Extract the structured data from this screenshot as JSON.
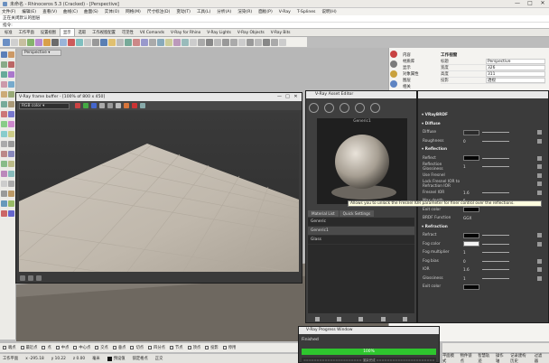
{
  "window": {
    "title": "未命名 - Rhinoceros 5.3 (Cracked) - [Perspective]",
    "min": "—",
    "max": "□",
    "close": "✕"
  },
  "menu": [
    "文件(F)",
    "编辑(E)",
    "查看(V)",
    "曲线(C)",
    "曲面(S)",
    "实体(O)",
    "网格(M)",
    "尺寸标注(D)",
    "变动(T)",
    "工具(L)",
    "分析(A)",
    "渲染(R)",
    "面板(P)",
    "V-Ray",
    "T-Splines",
    "说明(H)"
  ],
  "command": {
    "history": "正在关闭默认的图层",
    "prompt": "指令:"
  },
  "toolbar_tabs": [
    {
      "label": "标准",
      "active": false
    },
    {
      "label": "工作平面",
      "active": false
    },
    {
      "label": "设置视图",
      "active": false
    },
    {
      "label": "显示",
      "active": true
    },
    {
      "label": "选取",
      "active": false
    },
    {
      "label": "工作视窗配置",
      "active": false
    },
    {
      "label": "可见性",
      "active": false
    },
    {
      "label": "V4 Comands",
      "active": false
    },
    {
      "label": "V-Ray for Rhino",
      "active": false
    },
    {
      "label": "V-Ray Lights",
      "active": false
    },
    {
      "label": "V-Ray Objects",
      "active": false
    },
    {
      "label": "V-Ray Bits",
      "active": false
    }
  ],
  "viewport": {
    "label": "Perspective ▾"
  },
  "panel": {
    "list": [
      "内容",
      "材质库",
      "显示",
      "对象属性",
      "图层",
      "相关",
      "材质",
      "说明"
    ],
    "props_header": "工作视窗",
    "props": [
      {
        "k": "标题",
        "v": "Perspective"
      },
      {
        "k": "宽度",
        "v": "326"
      },
      {
        "k": "高度",
        "v": "311"
      },
      {
        "k": "投影",
        "v": "透视"
      }
    ]
  },
  "vfb": {
    "title": "V-Ray frame buffer - [100% of 800 x 450]",
    "channel": "RGB color ▾",
    "min": "—",
    "max": "□",
    "close": "✕"
  },
  "asset_editor": {
    "title": "V-Ray Asset Editor",
    "preview_label": "Generic1",
    "tabs": [
      "Material List",
      "Quick Settings"
    ],
    "items": [
      {
        "label": "Generic",
        "selected": false
      },
      {
        "label": "Generic1",
        "selected": true
      },
      {
        "label": "Glass",
        "selected": false
      }
    ]
  },
  "material": {
    "name": "VRayBRDF",
    "rows": [
      {
        "type": "section",
        "label": "▾ VRayBRDF"
      },
      {
        "type": "section",
        "label": "▾ Diffuse"
      },
      {
        "type": "row",
        "label": "Diffuse",
        "swatch": "#2b2b2b",
        "num": "",
        "slider": true,
        "check": true
      },
      {
        "type": "row",
        "label": "Roughness",
        "swatch": "",
        "num": "0",
        "slider": true,
        "check": true
      },
      {
        "type": "section",
        "label": "▾ Reflection"
      },
      {
        "type": "row",
        "label": "Reflect",
        "swatch": "#050505",
        "num": "",
        "slider": true,
        "check": true
      },
      {
        "type": "row",
        "label": "Reflection Glossiness",
        "swatch": "",
        "num": "1",
        "slider": true,
        "check": true
      },
      {
        "type": "row",
        "label": "Use Fresnel",
        "swatch": "",
        "num": "",
        "slider": false,
        "check": true
      },
      {
        "type": "row",
        "label": "Lock Fresnel IOR to Refraction IOR",
        "swatch": "",
        "num": "",
        "slider": false,
        "check": true
      },
      {
        "type": "row",
        "label": "Fresnel IOR",
        "swatch": "",
        "num": "1.6",
        "slider": true,
        "check": true
      },
      {
        "type": "row",
        "label": "Max depth",
        "swatch": "",
        "num": "5",
        "slider": true,
        "check": false
      },
      {
        "type": "row",
        "label": "Exit color",
        "swatch": "#050505",
        "num": "",
        "slider": false,
        "check": false
      },
      {
        "type": "row",
        "label": "BRDF Function",
        "swatch": "",
        "num": "GGX",
        "slider": false,
        "check": false
      },
      {
        "type": "section",
        "label": "▾ Refraction"
      },
      {
        "type": "row",
        "label": "Refract",
        "swatch": "#050505",
        "num": "",
        "slider": true,
        "check": true
      },
      {
        "type": "row",
        "label": "Fog color",
        "swatch": "#f4f4f4",
        "num": "",
        "slider": true,
        "check": true
      },
      {
        "type": "row",
        "label": "Fog multiplier",
        "swatch": "",
        "num": "1",
        "slider": true,
        "check": false
      },
      {
        "type": "row",
        "label": "Fog bias",
        "swatch": "",
        "num": "0",
        "slider": true,
        "check": true
      },
      {
        "type": "row",
        "label": "IOR",
        "swatch": "",
        "num": "1.6",
        "slider": true,
        "check": true
      },
      {
        "type": "row",
        "label": "Glossiness",
        "swatch": "",
        "num": "1",
        "slider": true,
        "check": true
      },
      {
        "type": "row",
        "label": "Exit color",
        "swatch": "#050505",
        "num": "",
        "slider": false,
        "check": false
      }
    ],
    "tooltip": "Allows you to unlock the Fresnel IOR parameter for finer control over the reflections."
  },
  "progress": {
    "title": "V-Ray Progress Window",
    "status": "Finished",
    "percent": "100%",
    "log": "====================== 渲染完成 ======================"
  },
  "osnap": [
    "端点",
    "最近点",
    "点",
    "中点",
    "中心点",
    "交点",
    "垂点",
    "切点",
    "四分点",
    "节点",
    "顶点",
    "投影",
    "停用"
  ],
  "status": {
    "plane": "工作平面",
    "x": "x -295.18",
    "y": "y 10.22",
    "z": "z 0.00",
    "unit": "毫米",
    "layer": "预设值",
    "snap1": "锁定格点",
    "snap2": "正交",
    "snap3": "平面模式",
    "snap4": "物件锁点",
    "snap5": "智慧轨迹",
    "snap6": "操作轴",
    "snap7": "记录建构历史",
    "snap8": "过滤器"
  },
  "colors": {
    "accent_green": "#2ec52e",
    "dark_panel": "#3b3b3b"
  }
}
